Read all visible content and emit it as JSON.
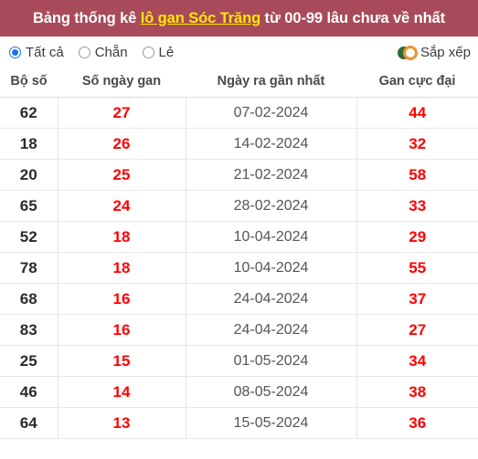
{
  "header": {
    "title_prefix": "Bảng thống kê ",
    "title_link": "lô gan Sóc Trăng",
    "title_suffix": " từ 00-99 lâu chưa về nhất",
    "background_color": "#a84a5a",
    "link_color": "#ffe800"
  },
  "filters": {
    "options": [
      {
        "label": "Tất cả",
        "selected": true
      },
      {
        "label": "Chẵn",
        "selected": false
      },
      {
        "label": "Lẻ",
        "selected": false
      }
    ],
    "sort": {
      "label": "Sắp xếp",
      "icon": "toggle-sort-icon",
      "accent_color": "#f0922b",
      "secondary_color": "#2f6b3a"
    }
  },
  "table": {
    "columns": [
      {
        "key": "bo_so",
        "label": "Bộ số"
      },
      {
        "key": "so_ngay_gan",
        "label": "Số ngày gan"
      },
      {
        "key": "ngay_ra_gan_nhat",
        "label": "Ngày ra gần nhất"
      },
      {
        "key": "gan_cuc_dai",
        "label": "Gan cực đại"
      }
    ],
    "value_colors": {
      "bo_so": "#2b2b2b",
      "so_ngay_gan": "#ff0000",
      "ngay_ra_gan_nhat": "#555555",
      "gan_cuc_dai": "#ff0000"
    },
    "rows": [
      {
        "bo_so": "62",
        "so_ngay_gan": "27",
        "ngay_ra_gan_nhat": "07-02-2024",
        "gan_cuc_dai": "44"
      },
      {
        "bo_so": "18",
        "so_ngay_gan": "26",
        "ngay_ra_gan_nhat": "14-02-2024",
        "gan_cuc_dai": "32"
      },
      {
        "bo_so": "20",
        "so_ngay_gan": "25",
        "ngay_ra_gan_nhat": "21-02-2024",
        "gan_cuc_dai": "58"
      },
      {
        "bo_so": "65",
        "so_ngay_gan": "24",
        "ngay_ra_gan_nhat": "28-02-2024",
        "gan_cuc_dai": "33"
      },
      {
        "bo_so": "52",
        "so_ngay_gan": "18",
        "ngay_ra_gan_nhat": "10-04-2024",
        "gan_cuc_dai": "29"
      },
      {
        "bo_so": "78",
        "so_ngay_gan": "18",
        "ngay_ra_gan_nhat": "10-04-2024",
        "gan_cuc_dai": "55"
      },
      {
        "bo_so": "68",
        "so_ngay_gan": "16",
        "ngay_ra_gan_nhat": "24-04-2024",
        "gan_cuc_dai": "37"
      },
      {
        "bo_so": "83",
        "so_ngay_gan": "16",
        "ngay_ra_gan_nhat": "24-04-2024",
        "gan_cuc_dai": "27"
      },
      {
        "bo_so": "25",
        "so_ngay_gan": "15",
        "ngay_ra_gan_nhat": "01-05-2024",
        "gan_cuc_dai": "34"
      },
      {
        "bo_so": "46",
        "so_ngay_gan": "14",
        "ngay_ra_gan_nhat": "08-05-2024",
        "gan_cuc_dai": "38"
      },
      {
        "bo_so": "64",
        "so_ngay_gan": "13",
        "ngay_ra_gan_nhat": "15-05-2024",
        "gan_cuc_dai": "36"
      }
    ]
  }
}
